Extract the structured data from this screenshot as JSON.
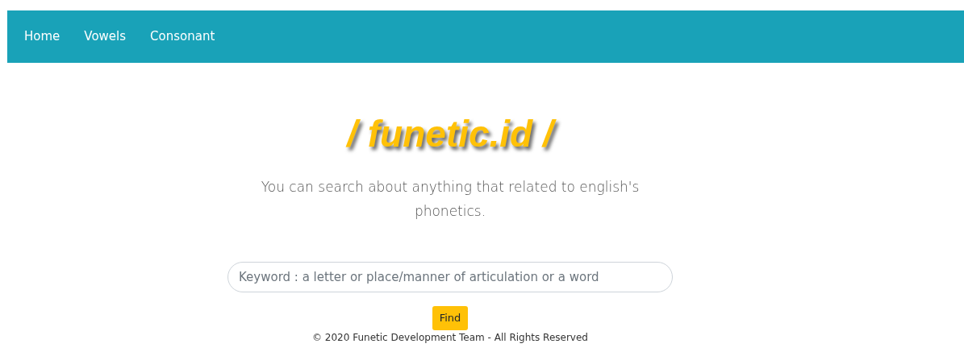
{
  "navbar": {
    "links": [
      "Home",
      "Vowels",
      "Consonant"
    ]
  },
  "logo": "/ funetic.id /",
  "tagline": "You can search about anything that related to english's phonetics.",
  "search": {
    "placeholder": "Keyword : a letter or place/manner of articulation or a word"
  },
  "find_button": "Find",
  "footer": "© 2020 Funetic Development Team - All Rights Reserved"
}
